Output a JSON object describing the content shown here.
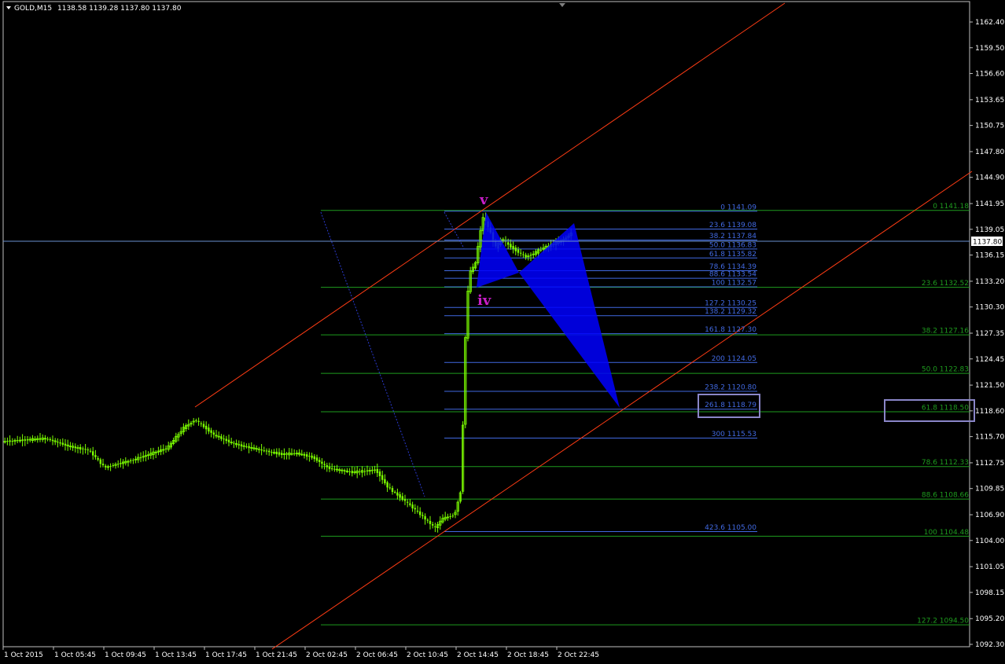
{
  "header": {
    "symbol_timeframe": "GOLD,M15",
    "ohlc": "1138.58 1139.28 1137.80 1137.80"
  },
  "colors": {
    "background": "#000000",
    "frame": "#c0c0c0",
    "candle": "#7cff00",
    "channel": "#ff3c14",
    "fib_blue": "#4169e1",
    "fib_green": "#1e9b1e",
    "pattern_fill": "#0000ff",
    "wave_label": "#c81ec8",
    "price_line": "#6a8fd0",
    "highlight_box": "#8a86c8"
  },
  "price_axis": {
    "ticks": [
      "1162.40",
      "1159.50",
      "1156.60",
      "1153.65",
      "1150.75",
      "1147.80",
      "1144.90",
      "1141.95",
      "1139.05",
      "1136.15",
      "1133.20",
      "1130.30",
      "1127.35",
      "1124.45",
      "1121.50",
      "1118.60",
      "1115.70",
      "1112.75",
      "1109.85",
      "1106.90",
      "1104.00",
      "1101.05",
      "1098.15",
      "1095.20",
      "1092.30"
    ],
    "current_price": "1137.80"
  },
  "time_axis": {
    "ticks": [
      "1 Oct 2015",
      "1 Oct 05:45",
      "1 Oct 09:45",
      "1 Oct 13:45",
      "1 Oct 17:45",
      "1 Oct 21:45",
      "2 Oct 02:45",
      "2 Oct 06:45",
      "2 Oct 10:45",
      "2 Oct 14:45",
      "2 Oct 18:45",
      "2 Oct 22:45"
    ]
  },
  "waves": {
    "v": "v",
    "iv": "iv"
  },
  "fib_blue": [
    {
      "label": "0 1141.09",
      "price": 1141.09
    },
    {
      "label": "23.6 1139.08",
      "price": 1139.08
    },
    {
      "label": "38.2 1137.84",
      "price": 1137.84
    },
    {
      "label": "50.0 1136.83",
      "price": 1136.83
    },
    {
      "label": "61.8 1135.82",
      "price": 1135.82
    },
    {
      "label": "78.6 1134.39",
      "price": 1134.39
    },
    {
      "label": "88.6 1133.54",
      "price": 1133.54
    },
    {
      "label": "100 1132.57",
      "price": 1132.57
    },
    {
      "label": "127.2 1130.25",
      "price": 1130.25
    },
    {
      "label": "138.2 1129.32",
      "price": 1129.32
    },
    {
      "label": "161.8 1127.30",
      "price": 1127.3
    },
    {
      "label": "200 1124.05",
      "price": 1124.05
    },
    {
      "label": "238.2 1120.80",
      "price": 1120.8
    },
    {
      "label": "261.8 1118.79",
      "price": 1118.79
    },
    {
      "label": "300 1115.53",
      "price": 1115.53
    },
    {
      "label": "423.6 1105.00",
      "price": 1105.0
    }
  ],
  "fib_green": [
    {
      "label": "0 1141.18",
      "price": 1141.18
    },
    {
      "label": "23.6 1132.52",
      "price": 1132.52
    },
    {
      "label": "38.2 1127.16",
      "price": 1127.16
    },
    {
      "label": "50.0 1122.83",
      "price": 1122.83
    },
    {
      "label": "61.8 1118.50",
      "price": 1118.5
    },
    {
      "label": "78.6 1112.33",
      "price": 1112.33
    },
    {
      "label": "88.6 1108.66",
      "price": 1108.66
    },
    {
      "label": "100 1104.48",
      "price": 1104.48
    },
    {
      "label": "127.2 1094.50",
      "price": 1094.5
    }
  ]
}
